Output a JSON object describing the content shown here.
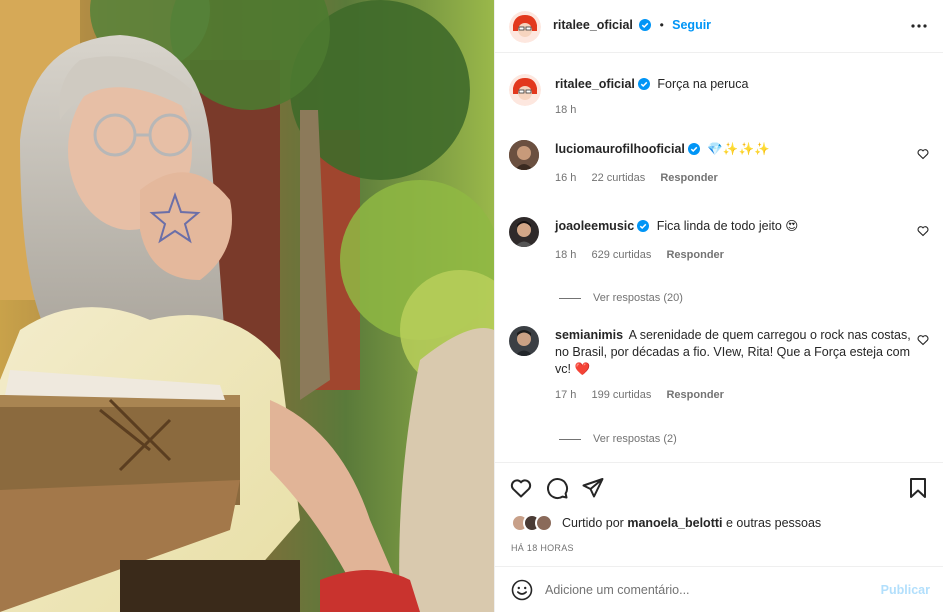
{
  "post": {
    "photo_alt": "",
    "author": "ritalee_oficial",
    "follow_label": "Seguir",
    "caption": "Força na peruca",
    "caption_time": "18 h"
  },
  "comments": [
    {
      "username": "luciomaurofilhooficial",
      "verified": true,
      "text": "💎✨✨✨",
      "time": "16 h",
      "likes": "22 curtidas",
      "reply_label": "Responder"
    },
    {
      "username": "joaoleemusic",
      "verified": true,
      "text": "Fica linda de todo jeito 😍",
      "time": "18 h",
      "likes": "629 curtidas",
      "reply_label": "Responder",
      "view_replies": "Ver respostas (20)"
    },
    {
      "username": "semianimis",
      "verified": false,
      "text": "A serenidade de quem carregou o rock nas costas, no Brasil, por décadas a fio. VIew, Rita! Que a Força esteja com vc! ❤️",
      "time": "17 h",
      "likes": "199 curtidas",
      "reply_label": "Responder",
      "view_replies": "Ver respostas (2)"
    }
  ],
  "likes": {
    "prefix": "Curtido por",
    "user": "manoela_belotti",
    "suffix": "e outras pessoas"
  },
  "timestamp": "HÁ 18 HORAS",
  "add_comment": {
    "placeholder": "Adicione um comentário...",
    "publish_label": "Publicar"
  },
  "colors": {
    "accent": "#0095f6",
    "publish_disabled": "#b2dffc",
    "verified": "#0095f6",
    "meta": "#737373"
  },
  "icons": {
    "like": "heart-outline-icon",
    "comment": "speech-bubble-icon",
    "share": "paper-plane-icon",
    "save": "bookmark-icon",
    "more": "ellipsis-icon",
    "emoji": "smiley-icon",
    "verified": "verified-badge-icon"
  }
}
